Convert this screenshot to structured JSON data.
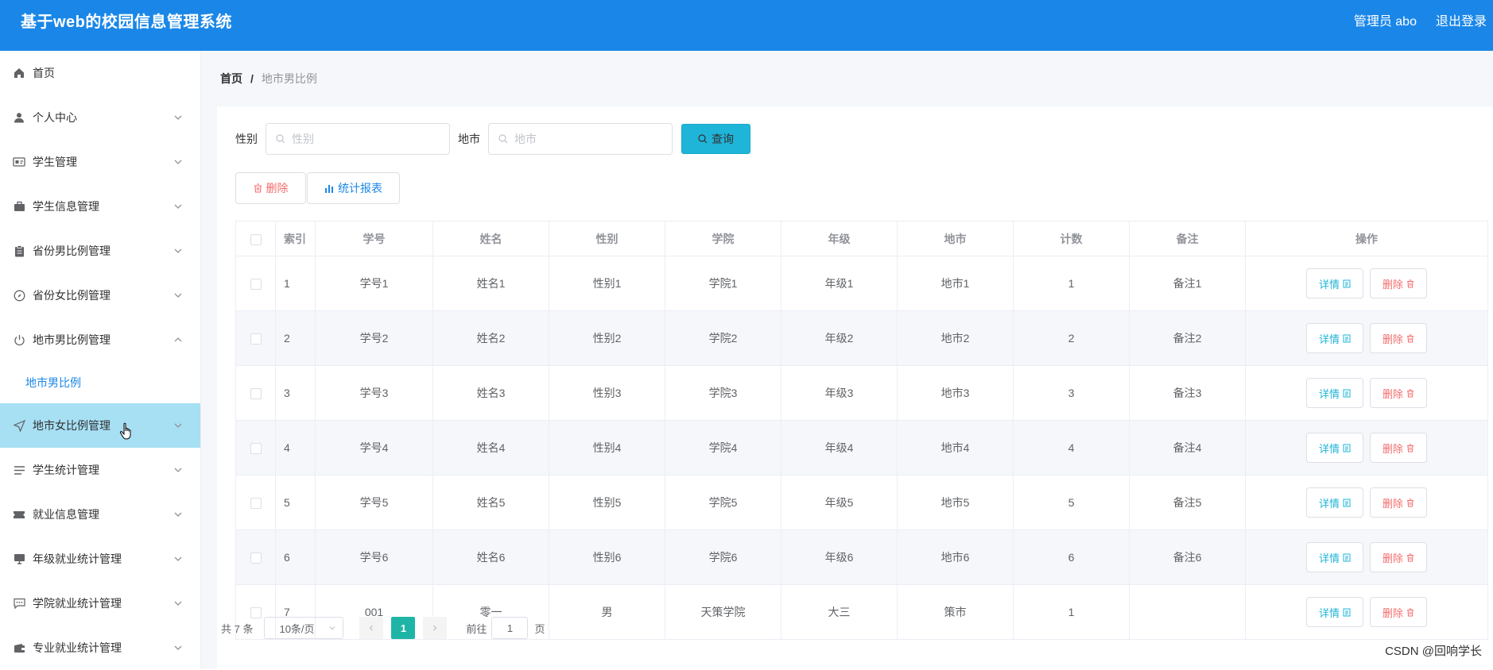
{
  "header": {
    "title": "基于web的校园信息管理系统",
    "user": "管理员 abo",
    "logout": "退出登录"
  },
  "sidebar": {
    "items": [
      {
        "label": "首页",
        "icon": "home-icon"
      },
      {
        "label": "个人中心",
        "icon": "user-icon"
      },
      {
        "label": "学生管理",
        "icon": "id-card-icon"
      },
      {
        "label": "学生信息管理",
        "icon": "briefcase-icon"
      },
      {
        "label": "省份男比例管理",
        "icon": "clipboard-icon"
      },
      {
        "label": "省份女比例管理",
        "icon": "compass-icon"
      },
      {
        "label": "地市男比例管理",
        "icon": "power-icon"
      },
      {
        "label": "地市女比例管理",
        "icon": "send-icon"
      },
      {
        "label": "学生统计管理",
        "icon": "list-icon"
      },
      {
        "label": "就业信息管理",
        "icon": "ticket-icon"
      },
      {
        "label": "年级就业统计管理",
        "icon": "monitor-icon"
      },
      {
        "label": "学院就业统计管理",
        "icon": "chat-icon"
      },
      {
        "label": "专业就业统计管理",
        "icon": "wallet-icon"
      }
    ],
    "submenu": {
      "label": "地市男比例"
    }
  },
  "breadcrumb": {
    "home": "首页",
    "sep": "/",
    "current": "地市男比例"
  },
  "search": {
    "gender_label": "性别",
    "gender_placeholder": "性别",
    "city_label": "地市",
    "city_placeholder": "地市",
    "query_label": "查询"
  },
  "actions": {
    "delete_label": "删除",
    "stats_label": "统计报表"
  },
  "table": {
    "columns": [
      "索引",
      "学号",
      "姓名",
      "性别",
      "学院",
      "年级",
      "地市",
      "计数",
      "备注",
      "操作"
    ],
    "rows": [
      [
        "1",
        "学号1",
        "姓名1",
        "性别1",
        "学院1",
        "年级1",
        "地市1",
        "1",
        "备注1"
      ],
      [
        "2",
        "学号2",
        "姓名2",
        "性别2",
        "学院2",
        "年级2",
        "地市2",
        "2",
        "备注2"
      ],
      [
        "3",
        "学号3",
        "姓名3",
        "性别3",
        "学院3",
        "年级3",
        "地市3",
        "3",
        "备注3"
      ],
      [
        "4",
        "学号4",
        "姓名4",
        "性别4",
        "学院4",
        "年级4",
        "地市4",
        "4",
        "备注4"
      ],
      [
        "5",
        "学号5",
        "姓名5",
        "性别5",
        "学院5",
        "年级5",
        "地市5",
        "5",
        "备注5"
      ],
      [
        "6",
        "学号6",
        "姓名6",
        "性别6",
        "学院6",
        "年级6",
        "地市6",
        "6",
        "备注6"
      ],
      [
        "7",
        "001",
        "零一",
        "男",
        "天策学院",
        "大三",
        "策市",
        "1",
        ""
      ]
    ],
    "detail_label": "详情",
    "remove_label": "删除"
  },
  "pagination": {
    "total": "共 7 条",
    "page_size": "10条/页",
    "current_page": "1",
    "goto_label": "前往",
    "goto_value": "1",
    "page_suffix": "页"
  },
  "watermark": "CSDN @回响学长"
}
